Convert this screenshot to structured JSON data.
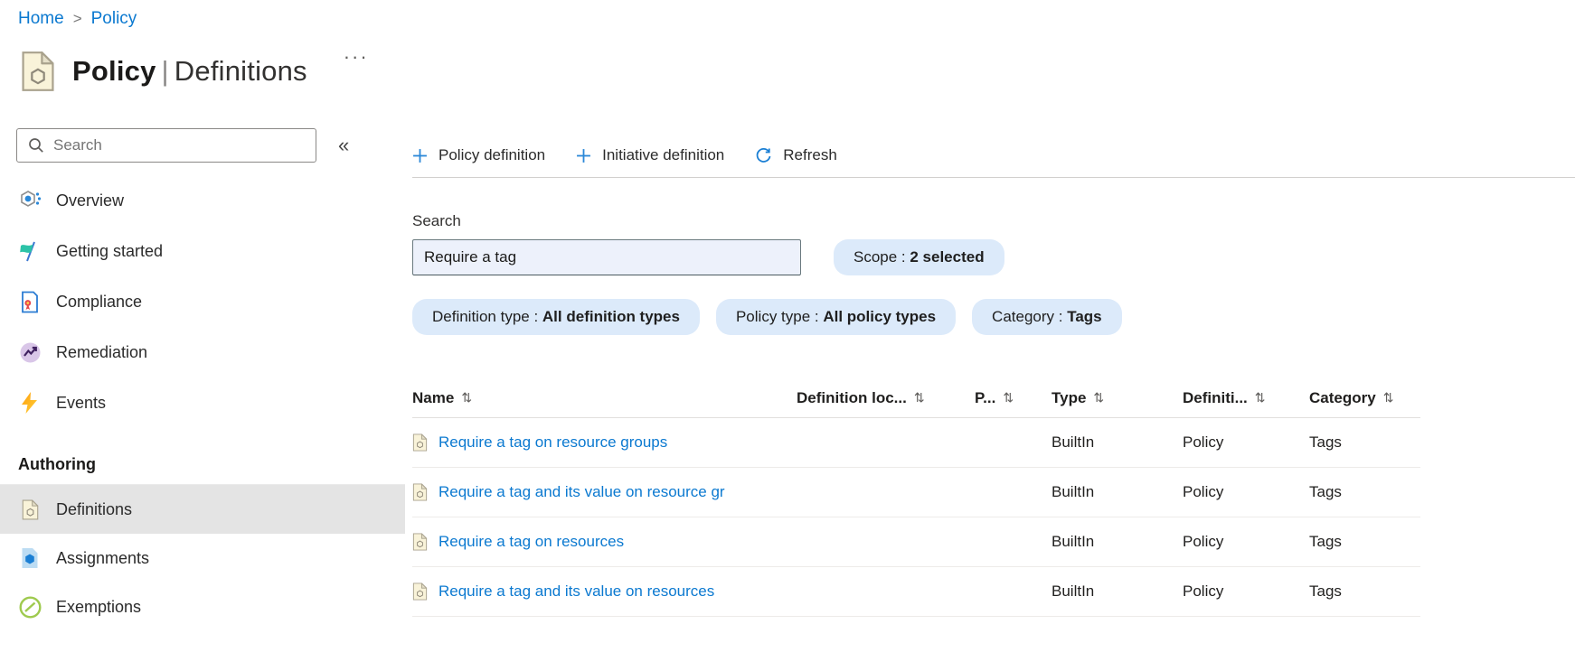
{
  "breadcrumb": {
    "separator": ">",
    "items": [
      {
        "label": "Home"
      },
      {
        "label": "Policy"
      }
    ]
  },
  "page": {
    "title_primary": "Policy",
    "title_divider": "|",
    "title_secondary": "Definitions",
    "more_menu": "···"
  },
  "sidebar": {
    "search": {
      "placeholder": "Search"
    },
    "collapse_icon": "«",
    "items": [
      {
        "label": "Overview",
        "icon": "overview-icon"
      },
      {
        "label": "Getting started",
        "icon": "getting-started-icon"
      },
      {
        "label": "Compliance",
        "icon": "compliance-icon"
      },
      {
        "label": "Remediation",
        "icon": "remediation-icon"
      },
      {
        "label": "Events",
        "icon": "events-icon"
      }
    ],
    "section": {
      "label": "Authoring",
      "items": [
        {
          "label": "Definitions",
          "icon": "definitions-icon",
          "selected": true
        },
        {
          "label": "Assignments",
          "icon": "assignments-icon",
          "selected": false
        },
        {
          "label": "Exemptions",
          "icon": "exemptions-icon",
          "selected": false
        }
      ]
    }
  },
  "toolbar": {
    "buttons": [
      {
        "label": "Policy definition",
        "icon": "plus-icon"
      },
      {
        "label": "Initiative definition",
        "icon": "plus-icon"
      },
      {
        "label": "Refresh",
        "icon": "refresh-icon"
      }
    ]
  },
  "filters": {
    "search_label": "Search",
    "search_value": "Require a tag",
    "separator": " : ",
    "pills": [
      {
        "name": "Scope",
        "value": "2 selected"
      },
      {
        "name": "Definition type",
        "value": "All definition types"
      },
      {
        "name": "Policy type",
        "value": "All policy types"
      },
      {
        "name": "Category",
        "value": "Tags"
      }
    ]
  },
  "table": {
    "sort_icon": "⇅",
    "columns": [
      {
        "label": "Name"
      },
      {
        "label": "Definition loc..."
      },
      {
        "label": "P..."
      },
      {
        "label": "Type"
      },
      {
        "label": "Definiti..."
      },
      {
        "label": "Category"
      }
    ],
    "rows": [
      {
        "name": "Require a tag on resource groups",
        "definition_location": "",
        "p": "",
        "type": "BuiltIn",
        "definition": "Policy",
        "category": "Tags"
      },
      {
        "name": "Require a tag and its value on resource gr",
        "definition_location": "",
        "p": "",
        "type": "BuiltIn",
        "definition": "Policy",
        "category": "Tags"
      },
      {
        "name": "Require a tag on resources",
        "definition_location": "",
        "p": "",
        "type": "BuiltIn",
        "definition": "Policy",
        "category": "Tags"
      },
      {
        "name": "Require a tag and its value on resources",
        "definition_location": "",
        "p": "",
        "type": "BuiltIn",
        "definition": "Policy",
        "category": "Tags"
      }
    ]
  },
  "colors": {
    "accent": "#0078d4",
    "link": "#0b79d0",
    "pill_bg": "#dceafa",
    "selected_bg": "#e4e4e4",
    "text": "#323130"
  }
}
